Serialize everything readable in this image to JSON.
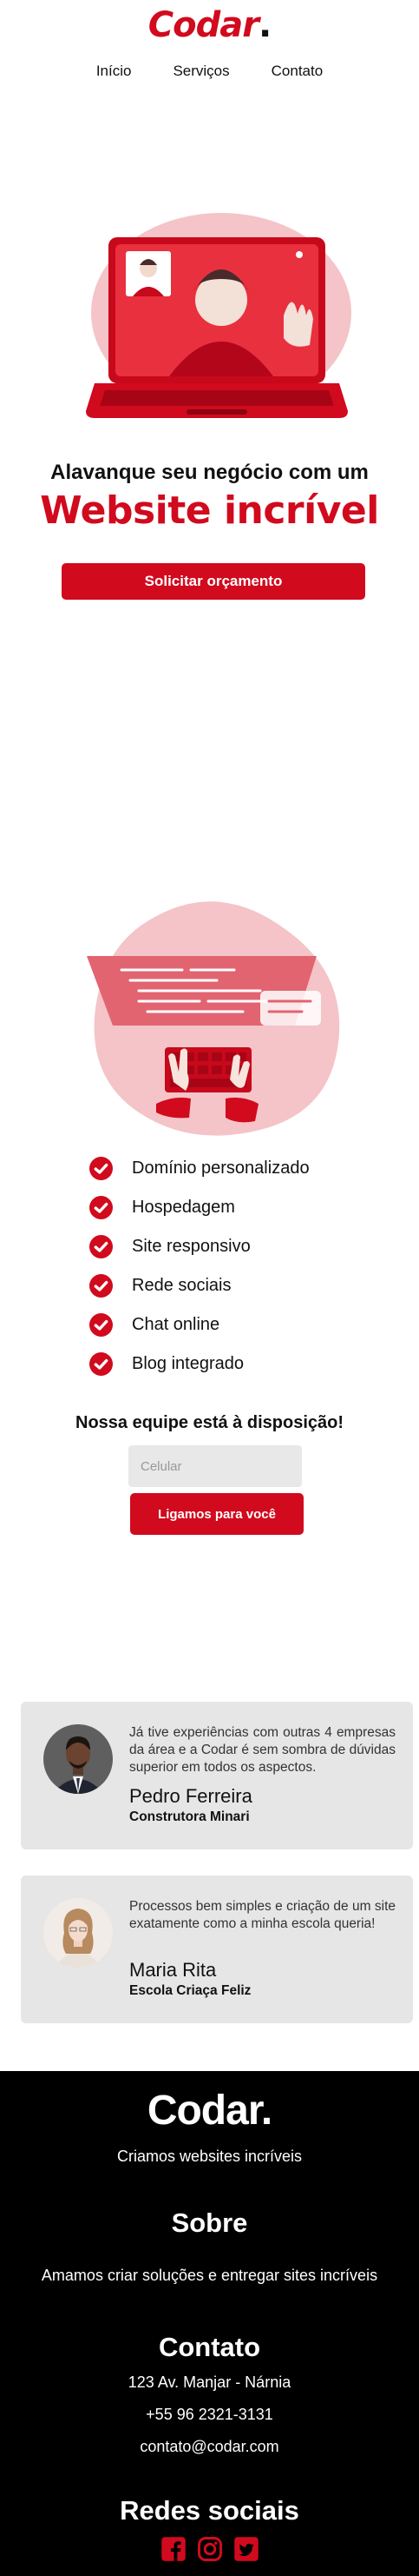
{
  "header": {
    "brand_text": "Codar",
    "brand_dot": ".",
    "nav": [
      "Início",
      "Serviços",
      "Contato"
    ]
  },
  "hero": {
    "subtitle": "Alavanque seu negócio com um",
    "title": "Website incrível",
    "cta_label": "Solicitar orçamento",
    "illustration_icon": "laptop-video-call-illustration"
  },
  "features": {
    "illustration_icon": "coding-keyboard-illustration",
    "items": [
      "Domínio personalizado",
      "Hospedagem",
      "Site responsivo",
      "Rede sociais",
      "Chat online",
      "Blog integrado"
    ],
    "item_icon": "check-circle-icon"
  },
  "callback": {
    "title": "Nossa equipe está à disposição!",
    "phone_placeholder": "Celular",
    "button_label": "Ligamos para você"
  },
  "testimonials": [
    {
      "quote": "Já tive experiências com outras 4 empresas da área e a Codar é sem sombra de dúvidas superior em todos os aspectos.",
      "name": "Pedro Ferreira",
      "company": "Construtora Minari"
    },
    {
      "quote": "Processos bem simples e criação de um site exatamente como a minha escola queria!",
      "name": "Maria Rita",
      "company": "Escola Criaça Feliz"
    }
  ],
  "footer": {
    "brand": "Codar.",
    "tagline": "Criamos websites incríveis",
    "about_title": "Sobre",
    "about_text": "Amamos criar soluções e entregar sites incríveis",
    "contact_title": "Contato",
    "address": "123 Av. Manjar - Nárnia",
    "phone": "+55 96 2321-3131",
    "email": "contato@codar.com",
    "social_title": "Redes sociais",
    "social_icons": [
      "facebook-icon",
      "instagram-icon",
      "twitter-icon"
    ]
  },
  "colors": {
    "accent": "#d10a1e",
    "card_bg": "#e6e6e6",
    "footer_bg": "#000000"
  }
}
